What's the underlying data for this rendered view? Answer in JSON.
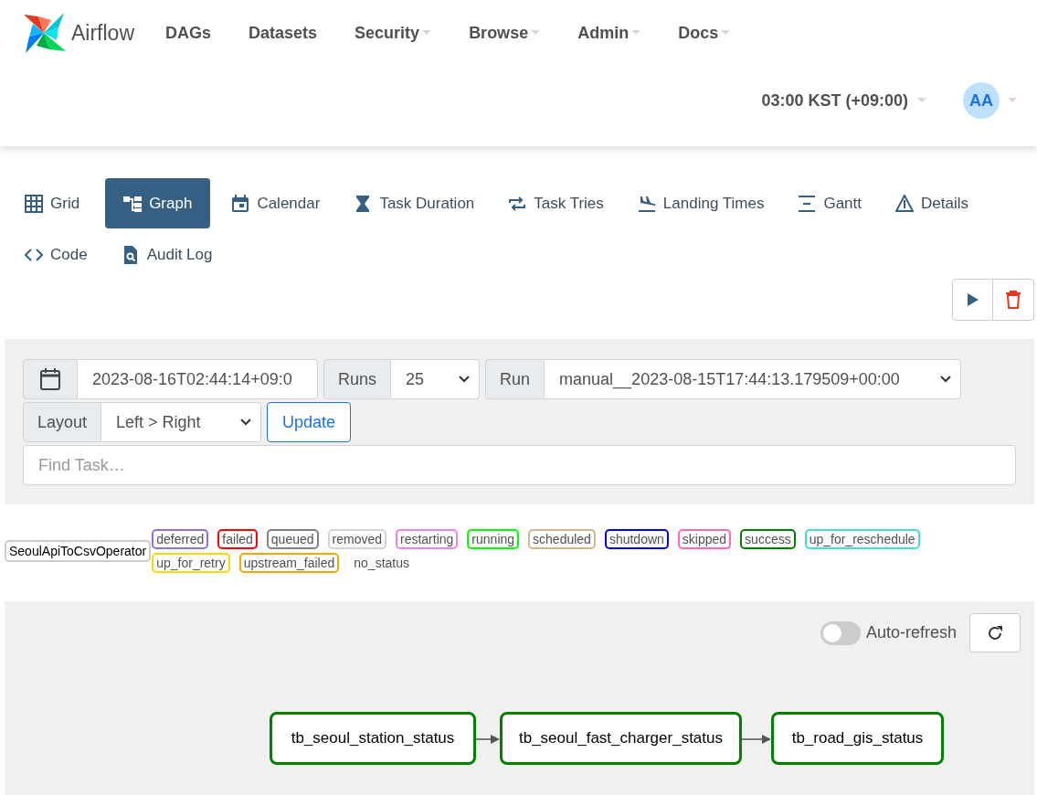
{
  "brand": {
    "name": "Airflow"
  },
  "nav": [
    {
      "label": "DAGs",
      "dropdown": false
    },
    {
      "label": "Datasets",
      "dropdown": false
    },
    {
      "label": "Security",
      "dropdown": true
    },
    {
      "label": "Browse",
      "dropdown": true
    },
    {
      "label": "Admin",
      "dropdown": true
    },
    {
      "label": "Docs",
      "dropdown": true
    }
  ],
  "timezone": "03:00 KST (+09:00)",
  "user": {
    "initials": "AA"
  },
  "tabs": [
    {
      "label": "Grid",
      "selected": false
    },
    {
      "label": "Graph",
      "selected": true
    },
    {
      "label": "Calendar",
      "selected": false
    },
    {
      "label": "Task Duration",
      "selected": false
    },
    {
      "label": "Task Tries",
      "selected": false
    },
    {
      "label": "Landing Times",
      "selected": false
    },
    {
      "label": "Gantt",
      "selected": false
    },
    {
      "label": "Details",
      "selected": false
    },
    {
      "label": "Code",
      "selected": false
    },
    {
      "label": "Audit Log",
      "selected": false
    }
  ],
  "controls": {
    "base_date": "2023-08-16T02:44:14+09:0",
    "runs_label": "Runs",
    "runs_value": "25",
    "run_label": "Run",
    "run_value": "manual__2023-08-15T17:44:13.179509+00:00",
    "layout_label": "Layout",
    "layout_value": "Left > Right",
    "update_button": "Update",
    "search": {
      "placeholder": "Find Task…"
    }
  },
  "legend": {
    "operator": "SeoulApiToCsvOperator",
    "states": [
      {
        "label": "deferred",
        "color": "#9370db"
      },
      {
        "label": "failed",
        "color": "#ff0000"
      },
      {
        "label": "queued",
        "color": "#808080"
      },
      {
        "label": "removed",
        "color": "#d3d3d3"
      },
      {
        "label": "restarting",
        "color": "#ee82ee"
      },
      {
        "label": "running",
        "color": "#00ff00"
      },
      {
        "label": "scheduled",
        "color": "#d2b48c"
      },
      {
        "label": "shutdown",
        "color": "#0000ff"
      },
      {
        "label": "skipped",
        "color": "#ff69b4"
      },
      {
        "label": "success",
        "color": "#008000"
      },
      {
        "label": "up_for_reschedule",
        "color": "#40e0d0"
      },
      {
        "label": "up_for_retry",
        "color": "#ffd700"
      },
      {
        "label": "upstream_failed",
        "color": "#ffa500"
      },
      {
        "label": "no_status"
      }
    ]
  },
  "graph": {
    "auto_refresh": {
      "label": "Auto-refresh",
      "on": false
    },
    "nodes": [
      {
        "label": "tb_seoul_station_status",
        "color": "#008000"
      },
      {
        "label": "tb_seoul_fast_charger_status",
        "color": "#008000"
      },
      {
        "label": "tb_road_gis_status",
        "color": "#008000"
      }
    ]
  }
}
